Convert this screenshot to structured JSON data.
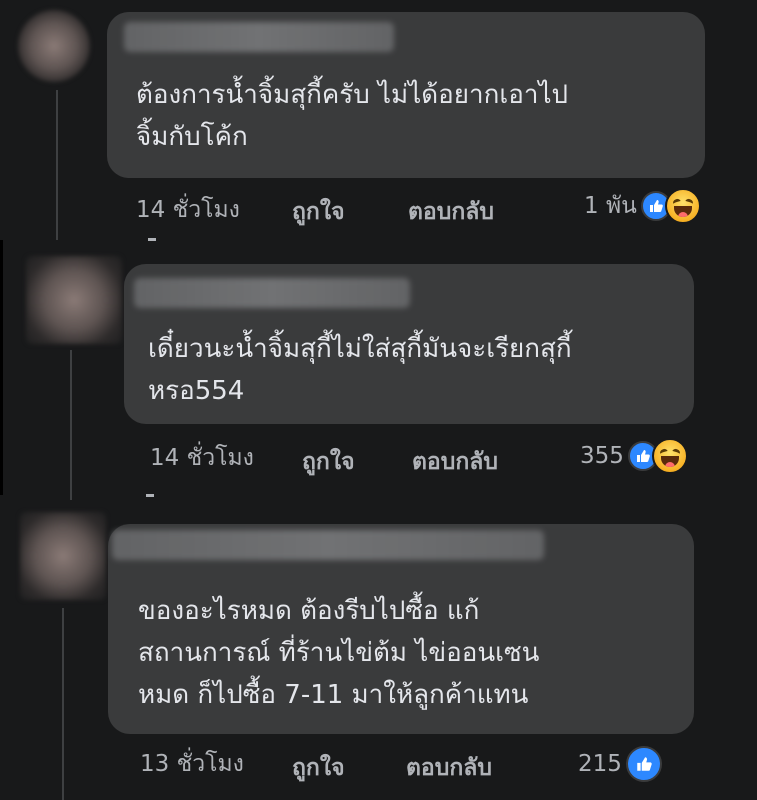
{
  "comments": [
    {
      "text": "ต้องการน้ำจิ้มสุกี้ครับ ไม่ได้อยากเอาไป\nจิ้มกับโค้ก",
      "time": "14 ชั่วโมง",
      "like_label": "ถูกใจ",
      "reply_label": "ตอบกลับ",
      "reaction_count": "1 พัน",
      "reactions": [
        "like-icon",
        "haha-icon"
      ]
    },
    {
      "text": "เดี๋ยวนะน้ำจิ้มสุกี้ไม่ใส่สุกี้มันจะเรียกสุกี้\nหรอ554",
      "time": "14 ชั่วโมง",
      "like_label": "ถูกใจ",
      "reply_label": "ตอบกลับ",
      "reaction_count": "355",
      "reactions": [
        "like-icon",
        "haha-icon"
      ]
    },
    {
      "text": "ของอะไรหมด ต้องรีบไปซื้อ แก้\nสถานการณ์ ที่ร้านไข่ต้ม ไข่ออนเซน\nหมด ก็ไปซื้อ 7-11 มาให้ลูกค้าแทน",
      "time": "13 ชั่วโมง",
      "like_label": "ถูกใจ",
      "reply_label": "ตอบกลับ",
      "reaction_count": "215",
      "reactions": [
        "like-icon"
      ]
    }
  ],
  "colors": {
    "background": "#18191a",
    "bubble": "#3a3b3c",
    "text": "#e4e6eb",
    "meta": "#b0b3b8",
    "like_blue": "#2d88ff",
    "haha_yellow": "#f7b125"
  }
}
